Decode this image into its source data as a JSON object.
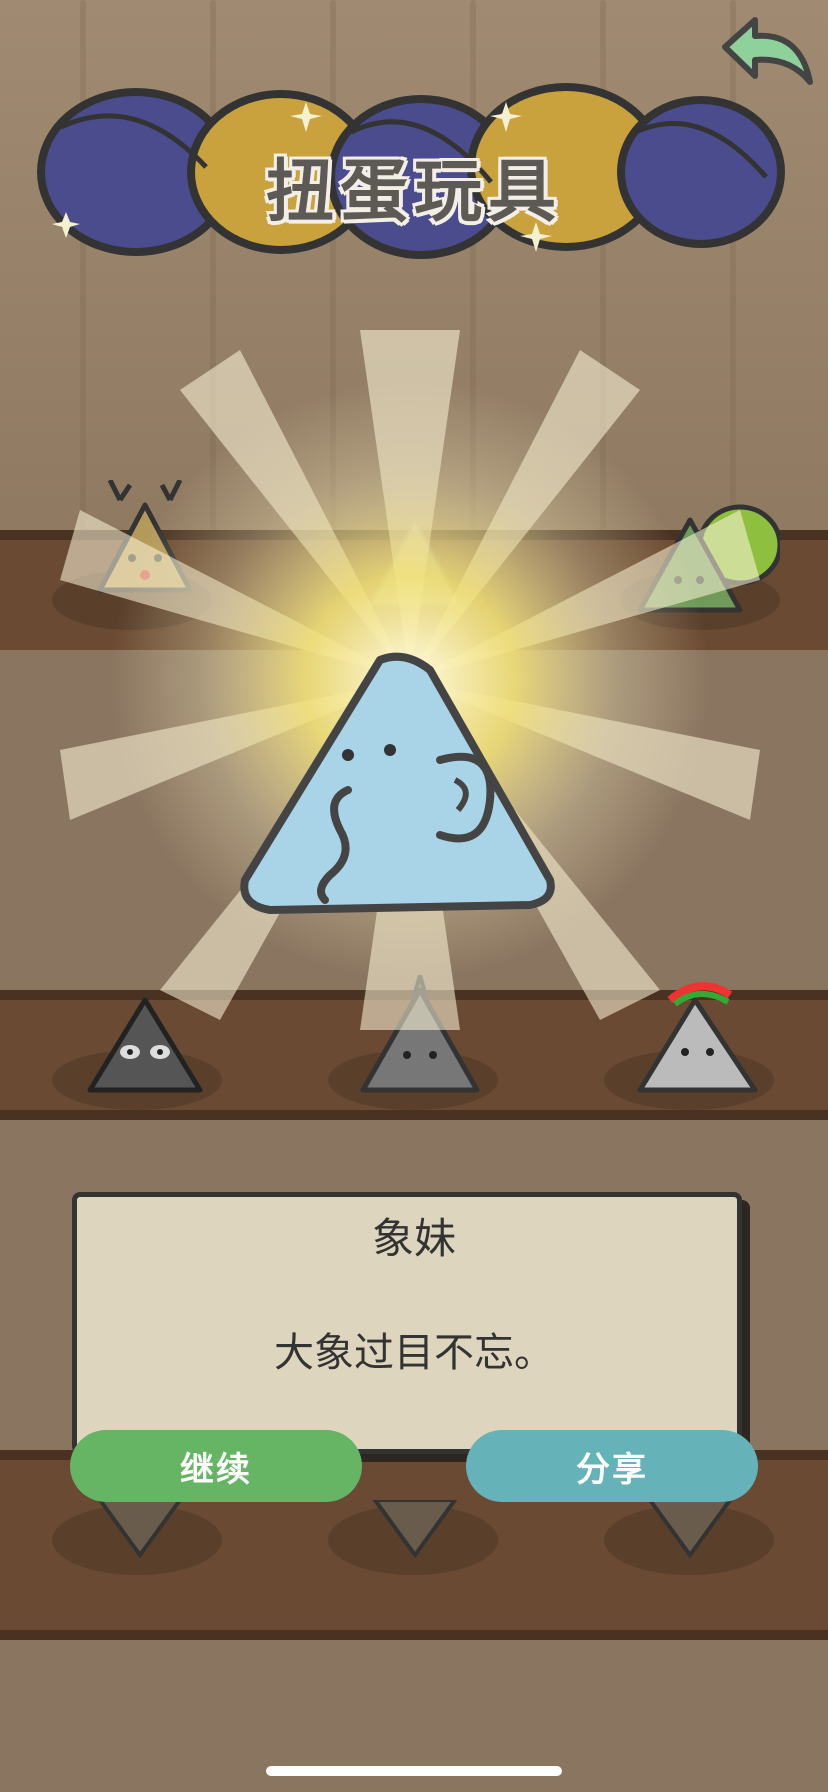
{
  "header": {
    "title": "扭蛋玩具"
  },
  "result": {
    "name": "象妹",
    "description": "大象过目不忘。"
  },
  "actions": {
    "continue_label": "继续",
    "share_label": "分享"
  },
  "colors": {
    "continue": "#66b564",
    "share": "#66b2b9",
    "dialog_bg": "#ddd5bd",
    "capsule_blue": "#4a4c8e",
    "capsule_yellow": "#c9a23d",
    "back_arrow": "#8fd19a"
  },
  "icons": {
    "back": "back-arrow-icon"
  }
}
